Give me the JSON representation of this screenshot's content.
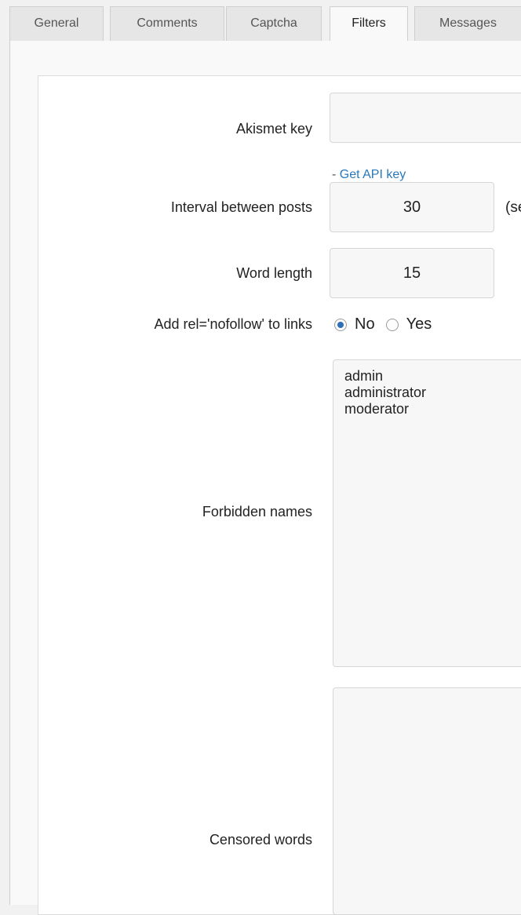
{
  "tabs": [
    {
      "label": "General",
      "active": false
    },
    {
      "label": "Comments",
      "active": false
    },
    {
      "label": "Captcha",
      "active": false
    },
    {
      "label": "Filters",
      "active": true
    },
    {
      "label": "Messages",
      "active": false
    }
  ],
  "fields": {
    "akismet_label": "Akismet key",
    "akismet_value": "",
    "api_link_prefix": "- ",
    "api_link_text": "Get API key",
    "interval_label": "Interval between posts",
    "interval_value": "30",
    "interval_suffix": "(se",
    "word_length_label": "Word length",
    "word_length_value": "15",
    "nofollow_label": "Add rel='nofollow' to links",
    "nofollow_options": [
      "No",
      "Yes"
    ],
    "nofollow_selected": "No",
    "forbidden_label": "Forbidden names",
    "forbidden_lines": [
      "admin",
      "administrator",
      "moderator"
    ],
    "censored_label": "Censored words",
    "censored_value": ""
  },
  "colors": {
    "link": "#2779b9",
    "radio_checked": "#2e6fb7"
  }
}
